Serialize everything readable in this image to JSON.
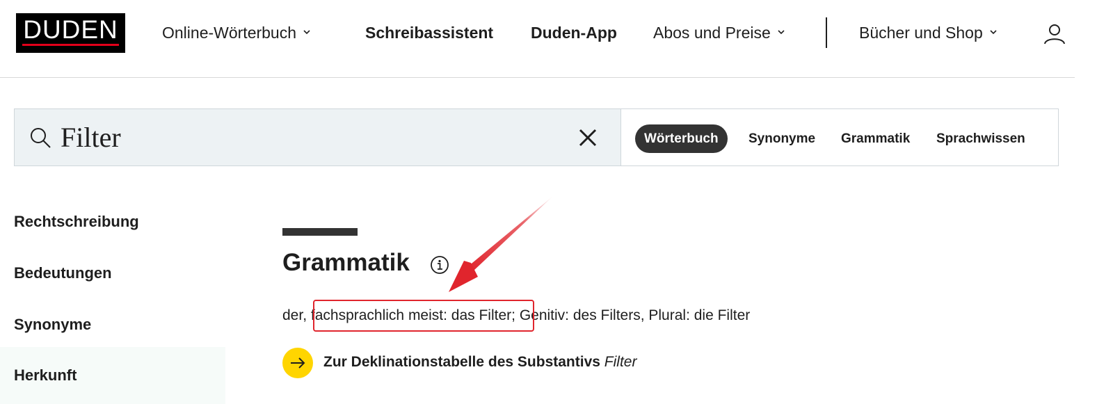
{
  "header": {
    "logo": "DUDEN",
    "nav": [
      {
        "label": "Online-Wörterbuch",
        "dropdown": true
      },
      {
        "label": "Schreibassistent",
        "dropdown": false
      },
      {
        "label": "Duden-App",
        "dropdown": false
      },
      {
        "label": "Abos und Preise",
        "dropdown": true
      },
      {
        "label": "Bücher und Shop",
        "dropdown": true
      }
    ],
    "user_icon": "user-icon"
  },
  "search": {
    "value": "Filter",
    "tabs": [
      {
        "label": "Wörterbuch",
        "active": true
      },
      {
        "label": "Synonyme",
        "active": false
      },
      {
        "label": "Grammatik",
        "active": false
      },
      {
        "label": "Sprachwissen",
        "active": false
      }
    ]
  },
  "sidebar": {
    "items": [
      {
        "label": "Rechtschreibung"
      },
      {
        "label": "Bedeutungen"
      },
      {
        "label": "Synonyme"
      },
      {
        "label": "Herkunft"
      }
    ]
  },
  "main": {
    "section_title": "Grammatik",
    "grammar": {
      "prefix": "der, ",
      "highlight": "fachsprachlich meist: das Filter",
      "suffix": "; Genitiv: des Filters, Plural: die Filter"
    },
    "declension_link": {
      "text": "Zur Deklinationstabelle des Substantivs ",
      "term": "Filter"
    }
  },
  "colors": {
    "brand_red": "#e2001a",
    "arrow_yellow": "#ffd500",
    "annotation_red": "#e0252d",
    "search_bg": "#edf2f4"
  }
}
